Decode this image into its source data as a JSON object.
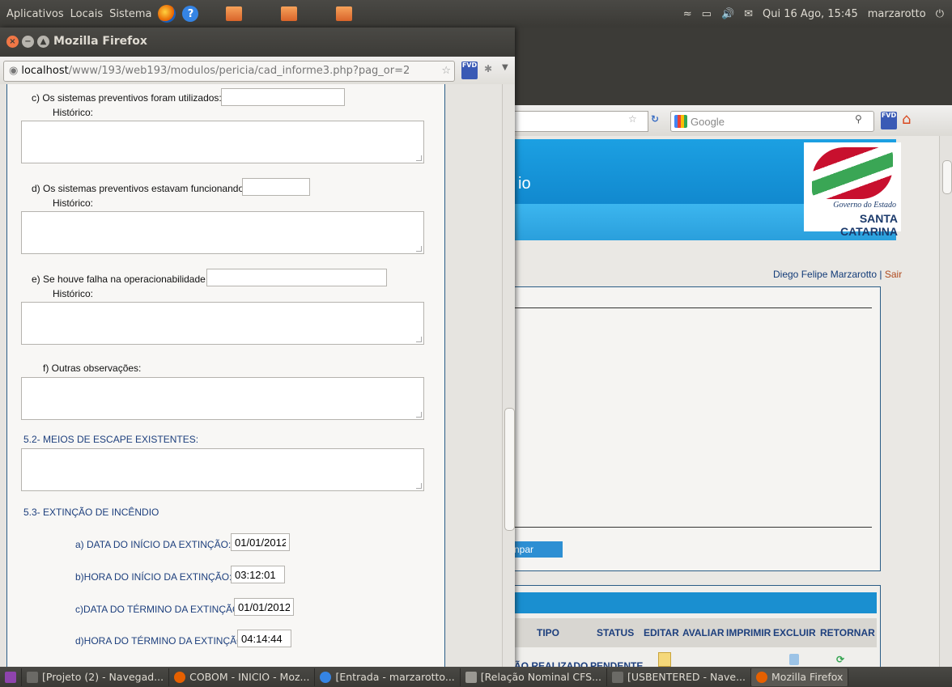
{
  "top_panel": {
    "menu_apps": "Aplicativos",
    "menu_places": "Locais",
    "menu_system": "Sistema",
    "clock": "Qui 16 Ago, 15:45",
    "user": "marzarotto"
  },
  "bg_browser": {
    "search_placeholder": "Google",
    "title_fragment": "io",
    "logo_gov": "Governo do Estado",
    "logo_state": "SANTA CATARINA",
    "user_name": "Diego Felipe Marzarotto",
    "separator": "|",
    "logout": "Sair",
    "limpar_fragment": "npar",
    "table_headers": [
      "TIPO",
      "STATUS",
      "EDITAR",
      "AVALIAR",
      "IMPRIMIR",
      "EXCLUIR",
      "RETORNAR"
    ],
    "row_tipo_fragment": "ÃO REALIZADO",
    "row_status": "PENDENTE"
  },
  "popup": {
    "title": "Mozilla Firefox",
    "url_host": "localhost",
    "url_path": "/www/193/web193/modulos/pericia/cad_informe3.php?pag_or=2",
    "fvd": "FVD"
  },
  "form": {
    "historico": "Histórico:",
    "q_c": "c) Os sistemas preventivos foram utilizados:",
    "q_d": "d) Os sistemas preventivos estavam funcionando:",
    "q_e": "e) Se houve falha na operacionabilidade:",
    "q_f": "f) Outras observações:",
    "sec_52": "5.2- MEIOS DE ESCAPE EXISTENTES:",
    "sec_53": "5.3- EXTINÇÃO DE INCÊNDIO",
    "a_label": "a) DATA DO INÍCIO DA EXTINÇÃO:",
    "a_value": "01/01/2012",
    "b_label": "b)HORA DO INÍCIO DA EXTINÇÃO:",
    "b_value": "03:12:01",
    "c_label": "c)DATA DO TÉRMINO DA EXTINÇÃO:",
    "c_value": "01/01/2012",
    "d_label": "d)HORA DO TÉRMINO DA EXTINÇÃO:",
    "d_value": "04:14:44"
  },
  "taskbar": {
    "items": [
      "[Projeto (2) - Navegad...",
      "COBOM - INICIO - Moz...",
      "[Entrada - marzarotto...",
      "[Relação Nominal CFS...",
      "[USBENTERED - Nave...",
      "Mozilla Firefox"
    ]
  }
}
